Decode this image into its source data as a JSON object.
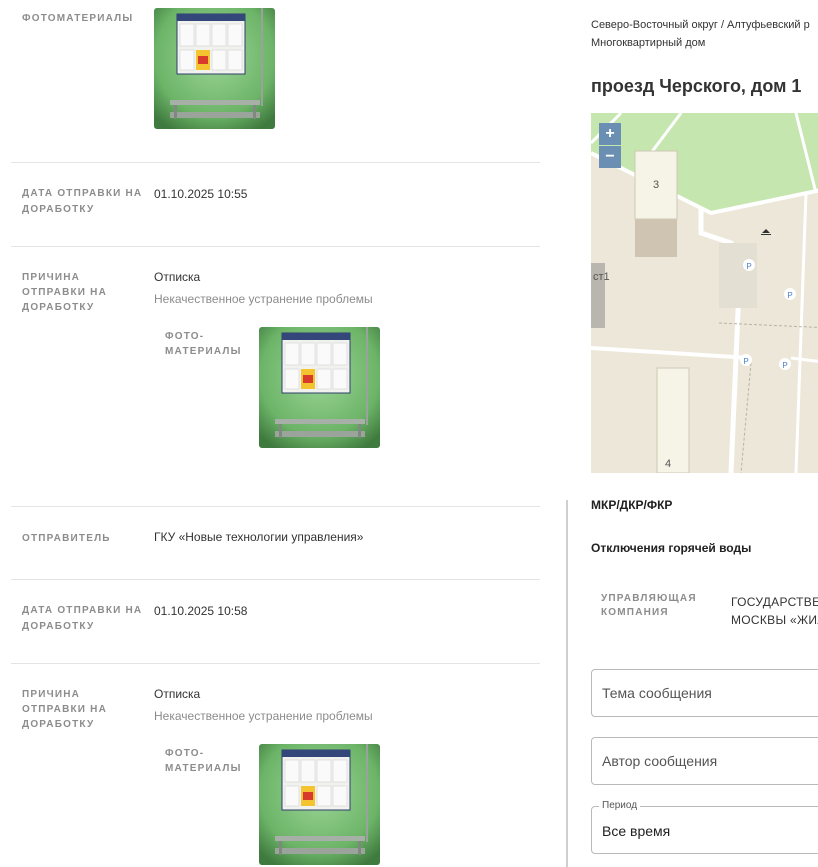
{
  "left": {
    "photos_label": "ФОТОМАТЕРИАЛЫ",
    "rows": [
      {
        "label1": "ДАТА ОТПРАВКИ НА",
        "label2": "ДОРАБОТКУ",
        "value": "01.10.2025 10:55"
      },
      {
        "reason_l1": "ПРИЧИНА",
        "reason_l2": "ОТПРАВКИ НА",
        "reason_l3": "ДОРАБОТКУ",
        "reason": "Отписка",
        "reason_detail": "Некачественное устранение проблемы",
        "photo_l1": "ФОТО-",
        "photo_l2": "МАТЕРИАЛЫ"
      },
      {
        "label": "ОТПРАВИТЕЛЬ",
        "value": "ГКУ «Новые технологии управления»"
      },
      {
        "label1": "ДАТА ОТПРАВКИ НА",
        "label2": "ДОРАБОТКУ",
        "value": "01.10.2025 10:58"
      },
      {
        "reason_l1": "ПРИЧИНА",
        "reason_l2": "ОТПРАВКИ НА",
        "reason_l3": "ДОРАБОТКУ",
        "reason": "Отписка",
        "reason_detail": "Некачественное устранение проблемы",
        "photo_l1": "ФОТО-",
        "photo_l2": "МАТЕРИАЛЫ"
      }
    ]
  },
  "right": {
    "breadcrumb": "Северо-Восточный округ / Алтуфьевский р",
    "building_type": "Многоквартирный дом",
    "address": "проезд Черского, дом 1",
    "map": {
      "zoom_in": "+",
      "zoom_out": "−",
      "labels": [
        "3",
        "4",
        "ст1"
      ],
      "parking": "P"
    },
    "program": "МКР/ДКР/ФКР",
    "outage": "Отключения горячей воды",
    "company_label1": "УПРАВЛЯЮЩАЯ",
    "company_label2": "КОМПАНИЯ",
    "company_value1": "ГОСУДАРСТВЕН",
    "company_value2": "МОСКВЫ «ЖИЛ",
    "form": {
      "topic_placeholder": "Тема сообщения",
      "author_placeholder": "Автор сообщения",
      "period_label": "Период",
      "period_value": "Все время"
    }
  },
  "colors": {
    "wall": "#7ec27a",
    "board": "#33477a",
    "map_bg": "#ece7d8",
    "map_green": "#bfe3a8",
    "zoom": "#6b8fb3"
  }
}
